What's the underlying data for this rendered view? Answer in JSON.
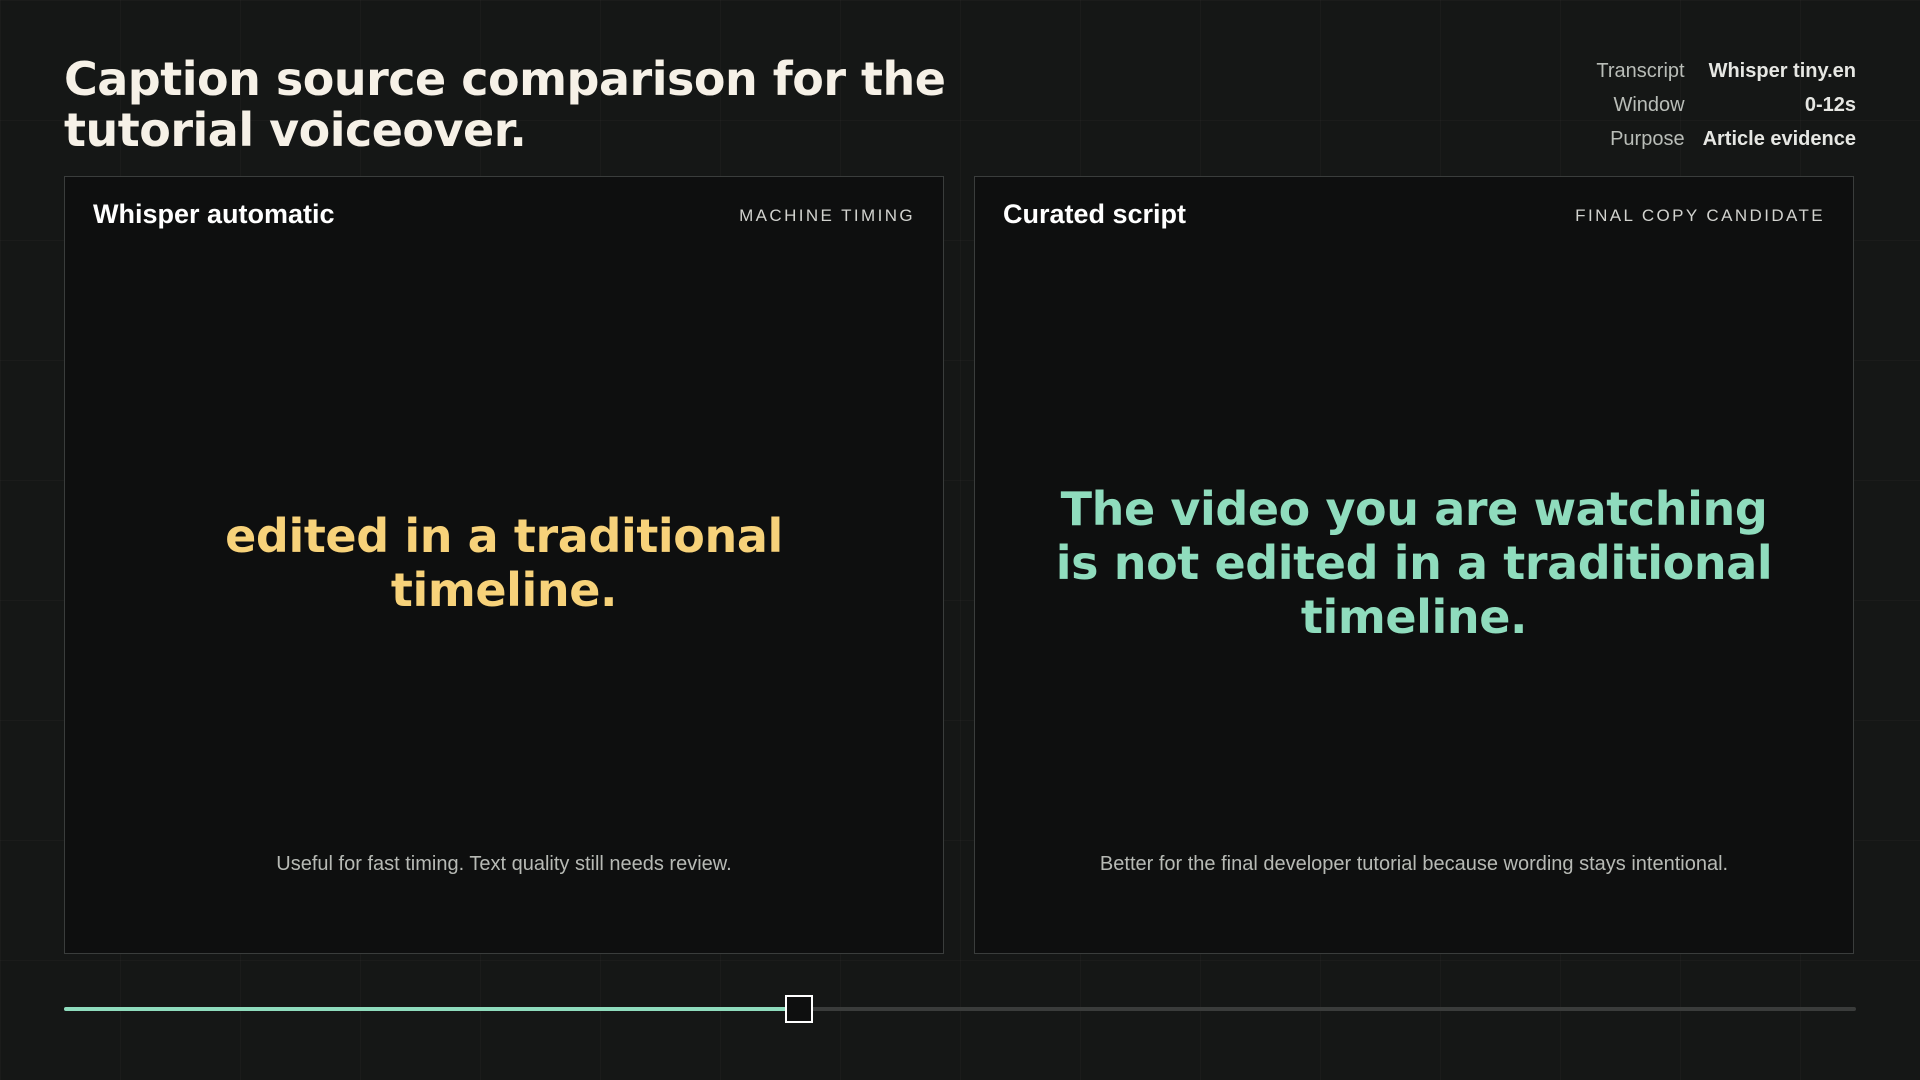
{
  "header": {
    "title": "Caption source comparison for the tutorial voiceover."
  },
  "meta": [
    {
      "label": "Transcript",
      "value": "Whisper tiny.en"
    },
    {
      "label": "Window",
      "value": "0-12s"
    },
    {
      "label": "Purpose",
      "value": "Article evidence"
    }
  ],
  "panels": {
    "whisper": {
      "name": "Whisper automatic",
      "tag": "MACHINE TIMING",
      "caption": "edited in a traditional timeline.",
      "note": "Useful for fast timing. Text quality still needs review.",
      "caption_color": "#f7d27a"
    },
    "curated": {
      "name": "Curated script",
      "tag": "FINAL COPY CANDIDATE",
      "caption": "The video you are watching is not edited in a traditional timeline.",
      "note": "Better for the final developer tutorial because wording stays intentional.",
      "caption_color": "#8fdcbd"
    }
  },
  "scrubber": {
    "progress": 0.41,
    "fill_color": "#8fdcbd"
  }
}
